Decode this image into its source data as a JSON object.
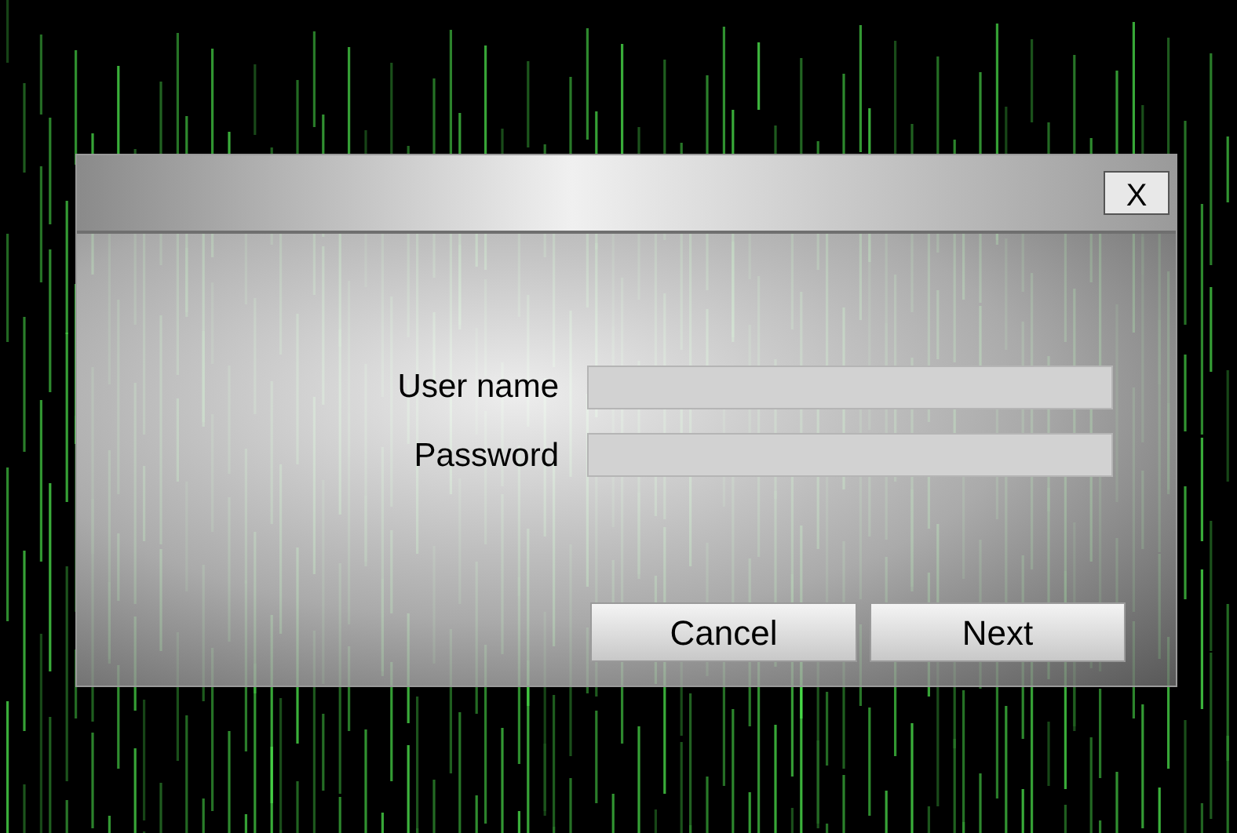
{
  "dialog": {
    "close_button": "X",
    "fields": [
      {
        "label": "User name"
      },
      {
        "label": "Password"
      }
    ],
    "buttons": [
      "Cancel",
      "Next"
    ]
  }
}
